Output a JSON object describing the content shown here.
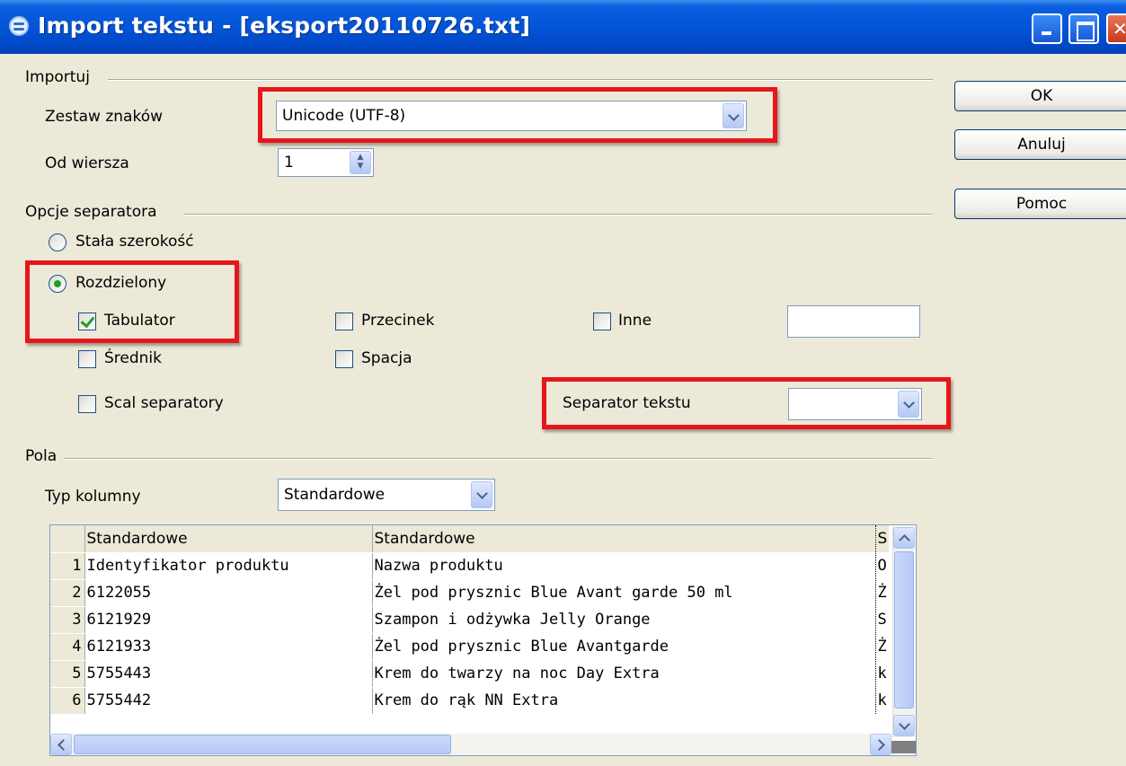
{
  "window": {
    "title": "Import tekstu - [eksport20110726.txt]"
  },
  "import_section": {
    "label": "Importuj",
    "charset_label": "Zestaw znaków",
    "charset_value": "Unicode (UTF-8)",
    "from_row_label": "Od wiersza",
    "from_row_value": "1"
  },
  "separator_section": {
    "label": "Opcje separatora",
    "fixed_width_label": "Stała szerokość",
    "separated_label": "Rozdzielony",
    "tab_label": "Tabulator",
    "comma_label": "Przecinek",
    "other_label": "Inne",
    "semicolon_label": "Średnik",
    "space_label": "Spacja",
    "merge_label": "Scal separatory",
    "text_delimiter_label": "Separator tekstu",
    "text_delimiter_value": "",
    "selected_mode": "separated",
    "checked": {
      "tab": true,
      "comma": false,
      "other": false,
      "semicolon": false,
      "space": false,
      "merge": false
    }
  },
  "fields_section": {
    "label": "Pola",
    "column_type_label": "Typ kolumny",
    "column_type_value": "Standardowe"
  },
  "preview": {
    "headers": [
      "Standardowe",
      "Standardowe",
      "S"
    ],
    "rows": [
      {
        "num": "1",
        "c1": "Identyfikator produktu",
        "c2": "Nazwa produktu",
        "c3": "O"
      },
      {
        "num": "2",
        "c1": "6122055",
        "c2": "Żel pod prysznic Blue Avant garde 50 ml",
        "c3": "Ż"
      },
      {
        "num": "3",
        "c1": "6121929",
        "c2": "Szampon i odżywka Jelly Orange",
        "c3": "S"
      },
      {
        "num": "4",
        "c1": "6121933",
        "c2": "Żel pod prysznic Blue Avantgarde",
        "c3": "Ż"
      },
      {
        "num": "5",
        "c1": "5755443",
        "c2": "Krem do twarzy na noc Day Extra",
        "c3": "k"
      },
      {
        "num": "6",
        "c1": "5755442",
        "c2": "Krem do rąk NN Extra",
        "c3": "k"
      }
    ]
  },
  "buttons": {
    "ok": "OK",
    "cancel": "Anuluj",
    "help": "Pomoc"
  },
  "colors": {
    "highlight": "#e8151a",
    "titlebar": "#0354d6",
    "dialog_bg": "#ece9d8"
  }
}
